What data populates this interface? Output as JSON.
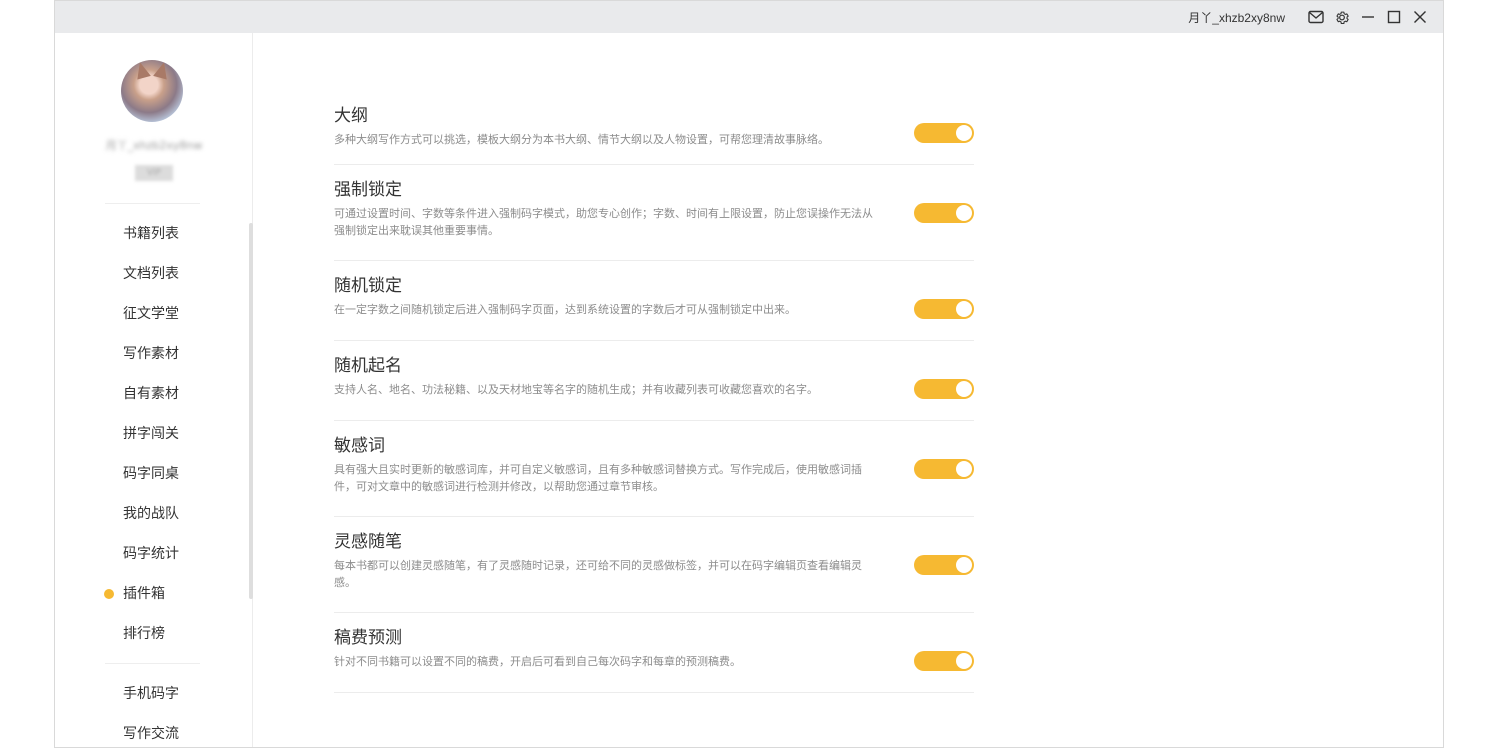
{
  "titlebar": {
    "username": "月丫_xhzb2xy8nw",
    "icons": [
      "mail-icon",
      "gear-icon",
      "minimize-icon",
      "maximize-icon",
      "close-icon"
    ]
  },
  "sidebar": {
    "username_blurred": "月丫_xhzb2xy8nw",
    "badge_blurred": "VIP",
    "items": [
      {
        "label": "书籍列表"
      },
      {
        "label": "文档列表"
      },
      {
        "label": "征文学堂"
      },
      {
        "label": "写作素材"
      },
      {
        "label": "自有素材"
      },
      {
        "label": "拼字闯关"
      },
      {
        "label": "码字同桌"
      },
      {
        "label": "我的战队"
      },
      {
        "label": "码字统计"
      },
      {
        "label": "插件箱",
        "active": true
      },
      {
        "label": "排行榜"
      }
    ],
    "items2": [
      {
        "label": "手机码字"
      },
      {
        "label": "写作交流"
      }
    ],
    "accent": "#f6b932"
  },
  "plugins": [
    {
      "name": "大纲",
      "desc": "多种大纲写作方式可以挑选，模板大纲分为本书大纲、情节大纲以及人物设置，可帮您理清故事脉络。",
      "enabled": true
    },
    {
      "name": "强制锁定",
      "desc": "可通过设置时间、字数等条件进入强制码字模式，助您专心创作；字数、时间有上限设置，防止您误操作无法从强制锁定出来耽误其他重要事情。",
      "enabled": true
    },
    {
      "name": "随机锁定",
      "desc": "在一定字数之间随机锁定后进入强制码字页面，达到系统设置的字数后才可从强制锁定中出来。",
      "enabled": true
    },
    {
      "name": "随机起名",
      "desc": "支持人名、地名、功法秘籍、以及天材地宝等名字的随机生成；并有收藏列表可收藏您喜欢的名字。",
      "enabled": true
    },
    {
      "name": "敏感词",
      "desc": "具有强大且实时更新的敏感词库，并可自定义敏感词，且有多种敏感词替换方式。写作完成后，使用敏感词插件，可对文章中的敏感词进行检测并修改，以帮助您通过章节审核。",
      "enabled": true
    },
    {
      "name": "灵感随笔",
      "desc": "每本书都可以创建灵感随笔，有了灵感随时记录，还可给不同的灵感做标签，并可以在码字编辑页查看编辑灵感。",
      "enabled": true
    },
    {
      "name": "稿费预测",
      "desc": "针对不同书籍可以设置不同的稿费，开启后可看到自己每次码字和每章的预测稿费。",
      "enabled": true
    }
  ]
}
